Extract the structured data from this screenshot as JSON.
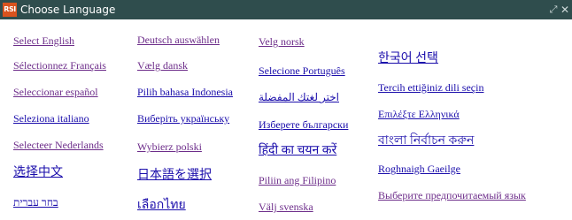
{
  "window": {
    "logo_text": "RSI",
    "title": "Choose Language",
    "maximize_icon": "⤢",
    "close_icon": "✕"
  },
  "colors": {
    "titlebar": "#2f4d4d",
    "visited_link": "#6d2d8a",
    "unvisited_link": "#1a0dab"
  },
  "columns": [
    [
      {
        "label": "Select English",
        "visited": true
      },
      {
        "label": "Sélectionnez Français",
        "visited": true
      },
      {
        "label": "Seleccionar español",
        "visited": true
      },
      {
        "label": "Seleziona italiano",
        "visited": false
      },
      {
        "label": "Selecteer Nederlands",
        "visited": true
      },
      {
        "label": "选择中文",
        "visited": false
      },
      {
        "label": "בחר עברית",
        "visited": false
      }
    ],
    [
      {
        "label": "Deutsch auswählen",
        "visited": true
      },
      {
        "label": "Vælg dansk",
        "visited": true
      },
      {
        "label": "Pilih bahasa Indonesia",
        "visited": false
      },
      {
        "label": "Виберіть українську",
        "visited": false
      },
      {
        "label": "Wybierz polski",
        "visited": true
      },
      {
        "label": "日本語を選択",
        "visited": false
      },
      {
        "label": "เลือกไทย",
        "visited": false
      }
    ],
    [
      {
        "label": "Velg norsk",
        "visited": true
      },
      {
        "label": "Selecione Português",
        "visited": false
      },
      {
        "label": "اختر لغتك المفضلة",
        "visited": false
      },
      {
        "label": "Изберете български",
        "visited": false
      },
      {
        "label": "हिंदी का चयन करें",
        "visited": false
      },
      {
        "label": "Piliin ang Filipino",
        "visited": true
      },
      {
        "label": "Välj svenska",
        "visited": true
      }
    ],
    [
      {
        "label": "한국어 선택",
        "visited": false
      },
      {
        "label": "Tercih ettiğiniz dili seçin",
        "visited": false
      },
      {
        "label": "Επιλέξτε Ελληνικά",
        "visited": false
      },
      {
        "label": "বাংলা নির্বাচন করুন",
        "visited": false
      },
      {
        "label": "Roghnaigh Gaeilge",
        "visited": false
      },
      {
        "label": "Выберите предпочитаемый язык",
        "visited": true
      }
    ]
  ]
}
